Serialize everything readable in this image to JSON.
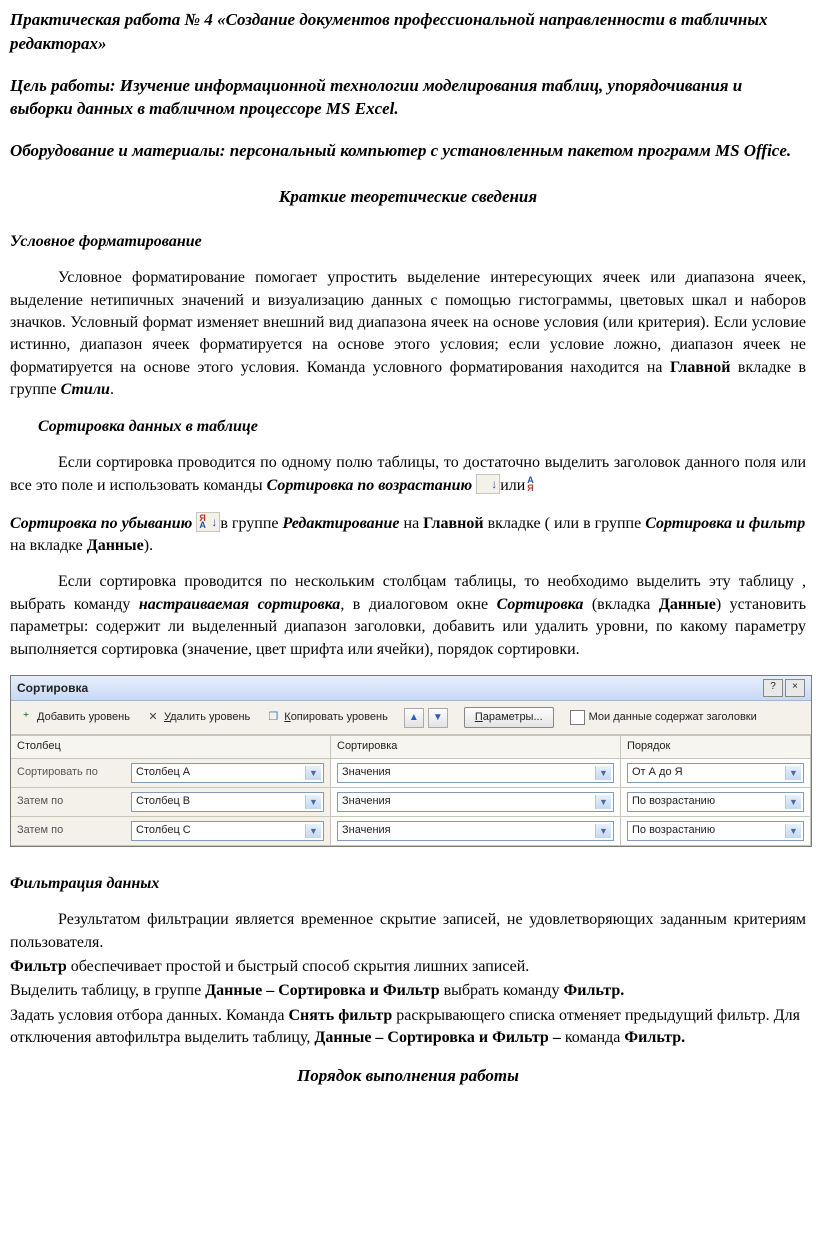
{
  "title": "Практическая работа № 4 «Создание документов профессиональной направленности в табличных редакторах»",
  "goal_prefix": "Цель работы: ",
  "goal": "Изучение информационной технологии моделирования таблиц, упорядочивания и выборки данных  в табличном процессоре MS Excel.",
  "equip_prefix": "Оборудование и материалы: ",
  "equip": "персональный компьютер с установленным пакетом программ MS Office.",
  "theory_heading": "Краткие теоретические сведения",
  "cond_heading": "Условное форматирование",
  "cond_p1_a": "Условное форматирование помогает упростить  выделение интересующих ячеек или диапазона ячеек, выделение нетипичных значений и визуализацию данных с помощью гистограммы, цветовых шкал и наборов значков. Условный формат изменяет внешний вид диапазона ячеек на основе условия (или критерия). Если условие истинно, диапазон ячеек форматируется на основе этого условия; если условие ложно, диапазон ячеек не форматируется на основе этого условия. Команда условного форматирования находится на ",
  "cond_p1_b": "Главной",
  "cond_p1_c": " вкладке в группе ",
  "cond_p1_d": "Стили",
  "cond_p1_e": ".",
  "sort_heading": "Сортировка данных в таблице",
  "sort_p1_a": "Если сортировка проводится по одному полю таблицы, то достаточно выделить заголовок данного поля  или все это поле и использовать команды ",
  "sort_p1_b": "Сортировка по возрастанию",
  "sort_p1_c": "или ",
  "sort_p2_a": "Сортировка по убыванию",
  "sort_p2_b": "в группе ",
  "sort_p2_c": "Редактирование",
  "sort_p2_d": " на ",
  "sort_p2_e": "Главной",
  "sort_p2_f": " вкладке ( или в группе ",
  "sort_p2_g": "Сортировка и фильтр",
  "sort_p2_h": " на вкладке ",
  "sort_p2_i": "Данные",
  "sort_p2_j": ").",
  "sort_p3_a": "Если сортировка проводится по нескольким столбцам  таблицы, то необходимо выделить эту таблицу , выбрать команду ",
  "sort_p3_b": "настраиваемая сортировка",
  "sort_p3_c": ", в диалоговом окне ",
  "sort_p3_d": "Сортировка",
  "sort_p3_e": " (вкладка ",
  "sort_p3_f": "Данные",
  "sort_p3_g": ") установить параметры:      содержит ли выделенный диапазон заголовки, добавить или удалить уровни, по какому параметру выполняется сортировка (значение, цвет шрифта или ячейки), порядок сортировки.",
  "dialog": {
    "title": "Сортировка",
    "add_level_pre": "Д",
    "add_level": "обавить уровень",
    "del_level_pre": "У",
    "del_level": "далить уровень",
    "copy_level_pre": "К",
    "copy_level": "опировать уровень",
    "params_pre": "П",
    "params": "араметры...",
    "headers_label": "Мои данные содержат заголовки",
    "col_header": "Столбец",
    "sort_header": "Сортировка",
    "order_header": "Порядок",
    "rows": [
      {
        "label": "Сортировать по",
        "column": "Столбец A",
        "sorton": "Значения",
        "order": "От А до Я"
      },
      {
        "label": "Затем по",
        "column": "Столбец B",
        "sorton": "Значения",
        "order": "По возрастанию"
      },
      {
        "label": "Затем по",
        "column": "Столбец C",
        "sorton": "Значения",
        "order": "По возрастанию"
      }
    ]
  },
  "filter_heading": "Фильтрация данных",
  "filter_p1": "Результатом фильтрации является временное скрытие записей, не удовлетворяющих заданным критериям пользователя.",
  "filter_p2_a": "Фильтр",
  "filter_p2_b": " обеспечивает простой и быстрый способ скрытия лишних записей.",
  "filter_p3_a": "Выделить таблицу,  в группе ",
  "filter_p3_b": "Данные – Сортировка и Фильтр",
  "filter_p3_c": " выбрать команду ",
  "filter_p3_d": "Фильтр.",
  "filter_p4_a": "Задать условия отбора данных. Команда ",
  "filter_p4_b": "Снять фильтр",
  "filter_p4_c": " раскрывающего списка отменяет предыдущий фильтр. Для отключения автофильтра  выделить таблицу, ",
  "filter_p4_d": "Данные – Сортировка и Фильтр – ",
  "filter_p4_e": "команда ",
  "filter_p4_f": "Фильтр.",
  "exec_heading": "Порядок выполнения работы"
}
